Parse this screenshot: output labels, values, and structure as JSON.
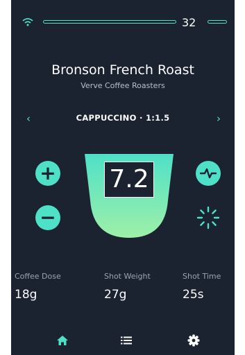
{
  "status": {
    "wifi_icon": "wifi-icon",
    "count": "32"
  },
  "coffee": {
    "name": "Bronson French Roast",
    "roaster": "Verve Coffee Roasters"
  },
  "mode": {
    "label": "CAPPUCCINO · 1:1.5",
    "prev_icon": "chevron-left-icon",
    "next_icon": "chevron-right-icon"
  },
  "controls": {
    "increase": "+",
    "decrease": "−",
    "pulse_icon": "pulse-icon",
    "spinner_icon": "spinner-icon"
  },
  "readout": {
    "value": "7.2"
  },
  "stats": [
    {
      "label": "Coffee Dose",
      "value": "18g"
    },
    {
      "label": "Shot Weight",
      "value": "27g"
    },
    {
      "label": "Shot Time",
      "value": "25s"
    }
  ],
  "nav": {
    "home_icon": "home-icon",
    "list_icon": "list-icon",
    "settings_icon": "gear-icon"
  },
  "colors": {
    "background": "#1b2230",
    "accent": "#4fe0c8",
    "gradient_end": "#9ef0a8",
    "text": "#ffffff"
  }
}
